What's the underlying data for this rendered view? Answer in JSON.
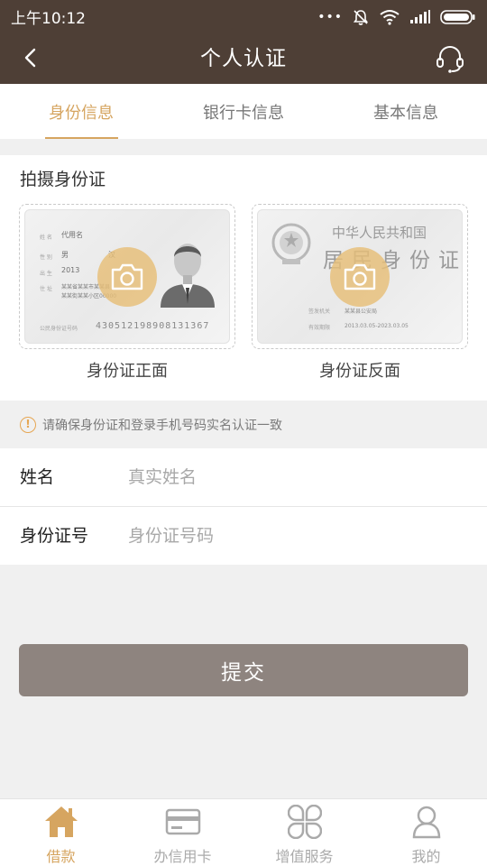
{
  "status_bar": {
    "time": "上午10:12",
    "dots": "•••"
  },
  "header": {
    "title": "个人认证"
  },
  "tabs": [
    {
      "label": "身份信息",
      "active": true
    },
    {
      "label": "银行卡信息",
      "active": false
    },
    {
      "label": "基本信息",
      "active": false
    }
  ],
  "id_section": {
    "title": "拍摄身份证",
    "front": {
      "caption": "身份证正面",
      "name_label": "姓 名",
      "name_value": "代用名",
      "gender_label": "性 别",
      "gender_value": "男",
      "nation_value": "汉",
      "birth_label": "出 生",
      "birth_value": "2013",
      "address_label": "住 址",
      "address_line1": "某某省某某市某某县",
      "address_line2": "某某街某某小区00000",
      "id_label": "公民身份证号码",
      "id_number": "430512198908131367"
    },
    "back": {
      "caption": "身份证反面",
      "country": "中华人民共和国",
      "card_name": "居民身份证",
      "authority_label": "签发机关",
      "authority_value": "某某县公安局",
      "validity_label": "有效期限",
      "validity_value": "2013.03.05-2023.03.05"
    }
  },
  "notice": {
    "icon": "!",
    "text": "请确保身份证和登录手机号码实名认证一致"
  },
  "form": {
    "name": {
      "label": "姓名",
      "placeholder": "真实姓名",
      "value": ""
    },
    "id": {
      "label": "身份证号",
      "placeholder": "身份证号码",
      "value": ""
    }
  },
  "submit_label": "提交",
  "bottom_nav": [
    {
      "label": "借款",
      "icon": "home-icon",
      "active": true
    },
    {
      "label": "办信用卡",
      "icon": "credit-card-icon",
      "active": false
    },
    {
      "label": "增值服务",
      "icon": "services-icon",
      "active": false
    },
    {
      "label": "我的",
      "icon": "user-icon",
      "active": false
    }
  ],
  "colors": {
    "header_bg": "#4e3f36",
    "accent": "#d6a560",
    "submit_bg": "#8e847f",
    "camera_badge": "#e7be78"
  }
}
